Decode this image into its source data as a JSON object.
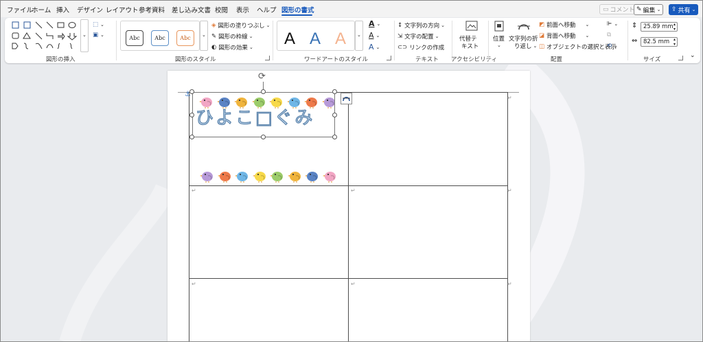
{
  "menu": {
    "items": [
      "ファイル",
      "ホーム",
      "挿入",
      "デザイン",
      "レイアウト",
      "参考資料",
      "差し込み文書",
      "校閲",
      "表示",
      "ヘルプ",
      "図形の書式"
    ],
    "active_index": 10,
    "comment_label": "コメント",
    "edit_label": "編集",
    "share_label": "共有"
  },
  "ribbon": {
    "groups": {
      "insert_shapes": "図形の挿入",
      "shape_styles": "図形のスタイル",
      "wordart_styles": "ワードアートのスタイル",
      "text": "テキスト",
      "accessibility": "アクセシビリティ",
      "arrange": "配置",
      "size": "サイズ"
    },
    "shape_style_sample": "Abc",
    "fill_label": "図形の塗りつぶし",
    "outline_label": "図形の枠線",
    "effects_label": "図形の効果",
    "wordart_letter": "A",
    "text_direction_label": "文字列の方向",
    "text_align_label": "文字の配置",
    "create_link_label": "リンクの作成",
    "alt_text_label_1": "代替テ",
    "alt_text_label_2": "キスト",
    "position_label": "位置",
    "wrap_text_label_1": "文字列の折",
    "wrap_text_label_2": "り返し",
    "bring_forward_label": "前面へ移動",
    "send_backward_label": "背面へ移動",
    "selection_pane_label": "オブジェクトの選択と表示",
    "height_value": "25.89 mm",
    "width_value": "82.5 mm"
  },
  "document": {
    "title_text": "ひよこ□ぐみ",
    "paragraph_mark": "↵",
    "bird_colors_top": [
      "#f2a6c4",
      "#5a83c4",
      "#f0b43c",
      "#9ccc6a",
      "#f7d94a",
      "#6fb6e6",
      "#ee7a4a",
      "#b79ad8"
    ],
    "bird_colors_bottom": [
      "#b79ad8",
      "#ee7a4a",
      "#6fb6e6",
      "#f7d94a",
      "#9ccc6a",
      "#f0b43c",
      "#5a83c4",
      "#f2a6c4"
    ]
  },
  "colors": {
    "accent": "#185abd",
    "title_fill": "#cfe3f5",
    "title_stroke": "#5f86ad"
  }
}
